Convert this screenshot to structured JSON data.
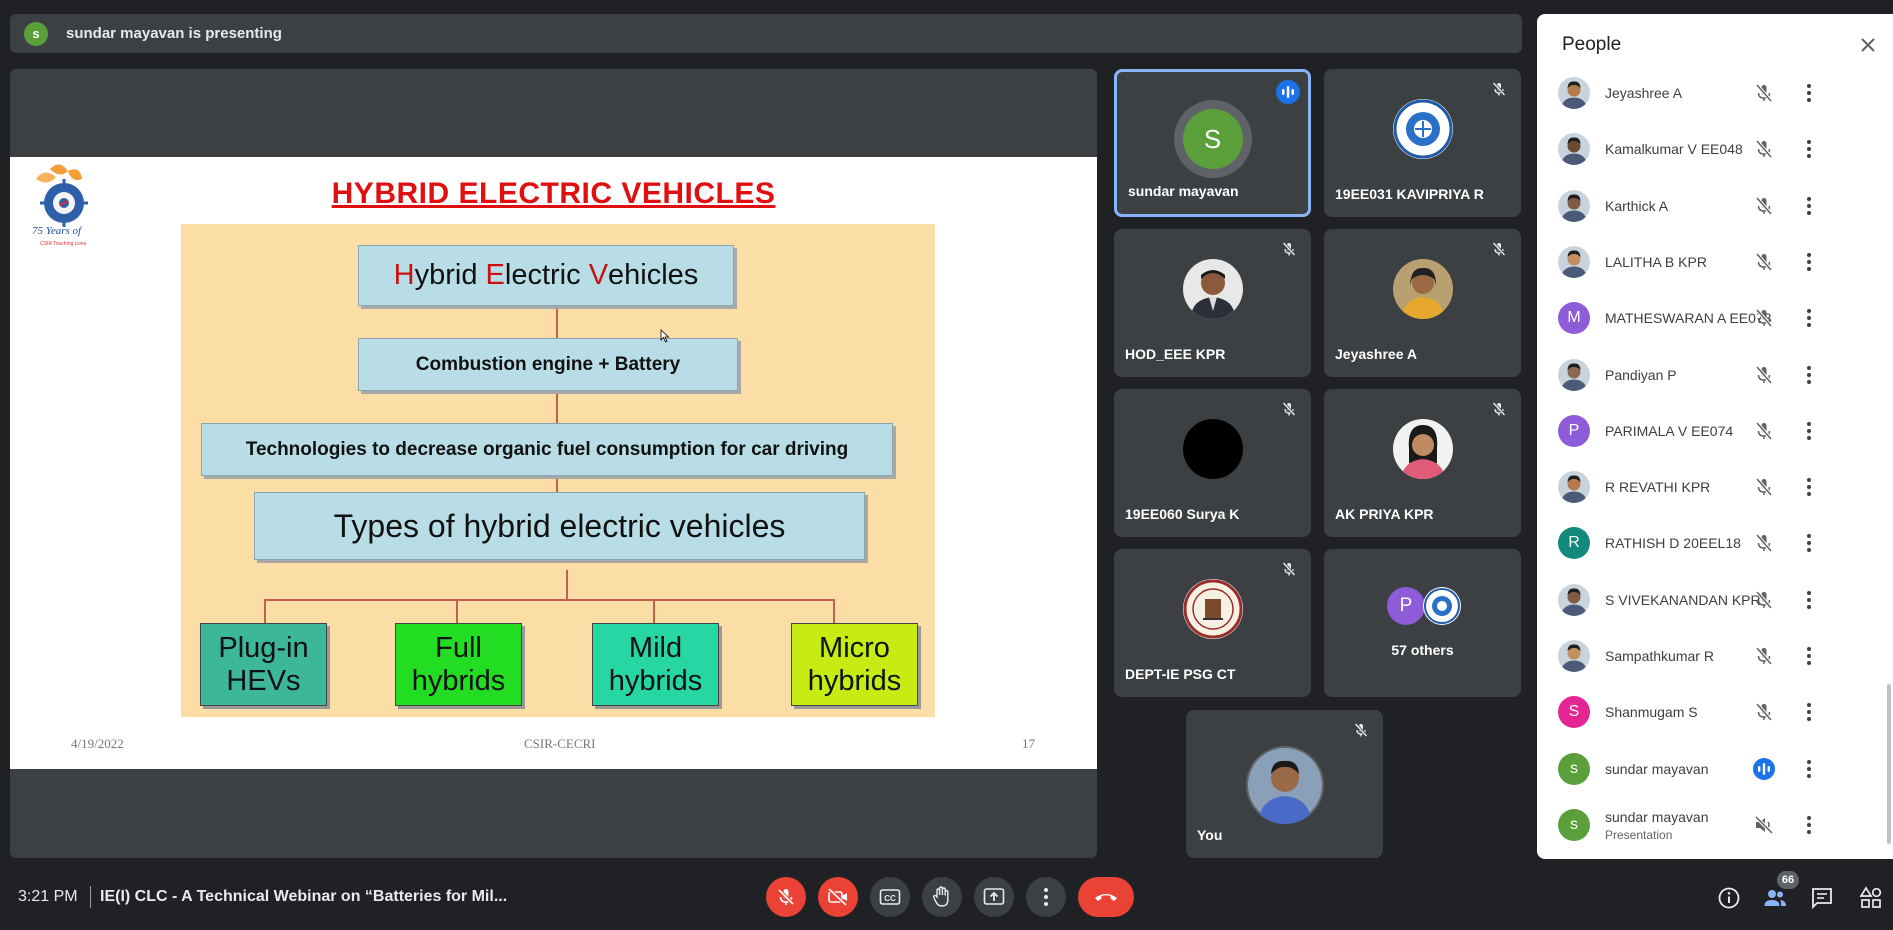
{
  "presenting_bar": {
    "avatar_letter": "s",
    "text": "sundar mayavan is presenting"
  },
  "slide": {
    "title": "HYBRID ELECTRIC VEHICLES",
    "logo_text": "75 Years of",
    "logo_sub": "CSIR Touching Lives",
    "box1": {
      "h": "H",
      "p1": "ybrid ",
      "e": "E",
      "p2": "lectric ",
      "v": "V",
      "p3": "ehicles"
    },
    "box2": "Combustion engine + Battery",
    "box3": "Technologies to decrease organic fuel consumption for car driving",
    "box4": "Types of hybrid electric vehicles",
    "categories": [
      {
        "line1": "Plug-in",
        "line2": "HEVs",
        "color": "#3cb79a"
      },
      {
        "line1": "Full",
        "line2": "hybrids",
        "color": "#22dd22"
      },
      {
        "line1": "Mild",
        "line2": "hybrids",
        "color": "#26d6a3"
      },
      {
        "line1": "Micro",
        "line2": "hybrids",
        "color": "#c6ec14"
      }
    ],
    "footer_date": "4/19/2022",
    "footer_center": "CSIR-CECRI",
    "footer_page": "17"
  },
  "tiles": [
    {
      "name": "sundar mayavan",
      "avatar_letter": "S",
      "avatar_color": "#5b9f3a",
      "state": "speaking"
    },
    {
      "name": "19EE031 KAVIPRIYA R",
      "avatar": "emblem-icon",
      "state": "muted"
    },
    {
      "name": "HOD_EEE KPR",
      "avatar": "photo",
      "state": "muted"
    },
    {
      "name": "Jeyashree A",
      "avatar": "photo",
      "state": "muted"
    },
    {
      "name": "19EE060 Surya K",
      "avatar": "black",
      "state": "muted"
    },
    {
      "name": "AK PRIYA KPR",
      "avatar": "photo",
      "state": "muted"
    },
    {
      "name": "DEPT-IE PSG CT",
      "avatar": "emblem-icon",
      "state": "muted"
    },
    {
      "name": "57 others",
      "avatar_letter": "P",
      "avatar_color": "#8e5cd9"
    },
    {
      "name": "You",
      "avatar": "photo",
      "state": "muted"
    }
  ],
  "people_panel": {
    "title": "People",
    "participants": [
      {
        "name": "Jeyashree A",
        "avatar": "photo",
        "mic": "muted"
      },
      {
        "name": "Kamalkumar V EE048",
        "avatar": "photo",
        "mic": "muted"
      },
      {
        "name": "Karthick A",
        "avatar": "photo",
        "mic": "muted"
      },
      {
        "name": "LALITHA B KPR",
        "avatar": "photo",
        "mic": "muted"
      },
      {
        "name": "MATHESWARAN A EE073",
        "avatar_letter": "M",
        "avatar_color": "#8e5cd9",
        "mic": "muted"
      },
      {
        "name": "Pandiyan P",
        "avatar": "photo",
        "mic": "muted"
      },
      {
        "name": "PARIMALA V EE074",
        "avatar_letter": "P",
        "avatar_color": "#8e5cd9",
        "mic": "muted"
      },
      {
        "name": "R REVATHI KPR",
        "avatar": "photo",
        "mic": "muted"
      },
      {
        "name": "RATHISH D 20EEL18",
        "avatar_letter": "R",
        "avatar_color": "#12897a",
        "mic": "muted"
      },
      {
        "name": "S VIVEKANANDAN KPR",
        "avatar": "photo",
        "mic": "muted"
      },
      {
        "name": "Sampathkumar R",
        "avatar": "photo",
        "mic": "muted"
      },
      {
        "name": "Shanmugam S",
        "avatar_letter": "S",
        "avatar_color": "#e52592",
        "mic": "muted"
      },
      {
        "name": "sundar mayavan",
        "avatar_letter": "s",
        "avatar_color": "#5b9f3a",
        "mic": "speaking"
      },
      {
        "name": "sundar mayavan",
        "sub": "Presentation",
        "avatar_letter": "s",
        "avatar_color": "#5b9f3a",
        "mic": "audio-off"
      }
    ]
  },
  "bottom_bar": {
    "time": "3:21 PM",
    "meeting_title": "IE(I) CLC - A Technical Webinar on “Batteries for Mil...",
    "people_count": "66"
  },
  "colors": {
    "accent": "#8ab4f8",
    "danger": "#ea4335",
    "speaking": "#1a73e8"
  }
}
